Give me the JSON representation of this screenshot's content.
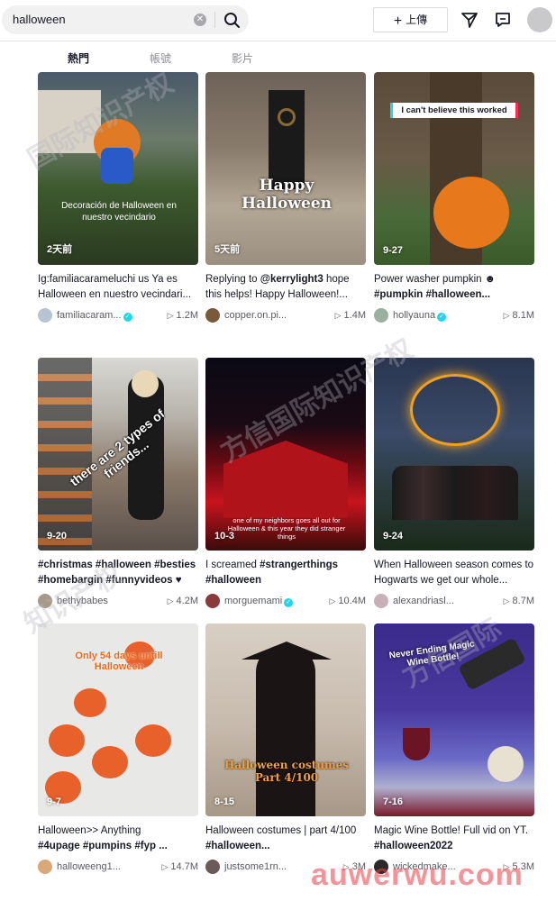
{
  "search": {
    "value": "halloween",
    "clear_icon": "close-circle-icon",
    "button_icon": "search-icon"
  },
  "header": {
    "upload_label": "上傳",
    "upload_icon": "plus-icon",
    "inbox_icon": "paper-plane-icon",
    "messages_icon": "message-icon"
  },
  "tabs": [
    {
      "label": "熱門",
      "active": true
    },
    {
      "label": "帳號",
      "active": false
    },
    {
      "label": "影片",
      "active": false
    }
  ],
  "videos": [
    {
      "date": "2天前",
      "overlay": "Decoración de Halloween en nuestro vecindario",
      "caption_plain": "Ig:familiacarameluchi us Ya es Halloween en nuestro vecindari...",
      "caption_tags": "",
      "user": "familiacaram...",
      "verified": true,
      "views": "1.2M"
    },
    {
      "date": "5天前",
      "overlay": "Happy Halloween",
      "caption_plain": "Replying to ",
      "caption_tags": "@kerrylight3",
      "caption_after": " hope this helps! Happy Halloween!...",
      "user": "copper.on.pi...",
      "verified": false,
      "views": "1.4M"
    },
    {
      "date": "9-27",
      "overlay": "I can't believe this worked",
      "caption_plain": "Power washer pumpkin ",
      "caption_tags": "#pumpkin #halloween...",
      "user": "hollyauna",
      "verified": true,
      "views": "8.1M"
    },
    {
      "date": "9-20",
      "overlay": "there are 2 types of friends...",
      "caption_plain": "",
      "caption_tags": "#christmas #halloween #besties #homebargin #funnyvideos",
      "user": "bethybabes",
      "verified": false,
      "views": "4.2M"
    },
    {
      "date": "10-3",
      "overlay": "one of my neighbors goes all out for Halloween & this year they did stranger things",
      "caption_plain": "I screamed ",
      "caption_tags": "#strangerthings #halloween",
      "user": "morguemami",
      "verified": true,
      "views": "10.4M"
    },
    {
      "date": "9-24",
      "overlay": "",
      "caption_plain": "When Halloween season comes to Hogwarts we get our whole...",
      "caption_tags": "",
      "user": "alexandriasl...",
      "verified": false,
      "views": "8.7M"
    },
    {
      "date": "9-7",
      "overlay": "Only 54 days untill Halloween",
      "caption_plain": "Halloween>> Anything ",
      "caption_tags": "#4upage #pumpins #fyp ...",
      "user": "halloweeng1...",
      "verified": false,
      "views": "14.7M"
    },
    {
      "date": "8-15",
      "overlay": "Halloween costumes Part 4/100",
      "caption_plain": "Halloween costumes | part 4/100 ",
      "caption_tags": "#halloween...",
      "user": "justsome1rn...",
      "verified": false,
      "views": "3M"
    },
    {
      "date": "7-16",
      "overlay": "Never Ending Magic Wine Bottle!",
      "caption_plain": "Magic Wine Bottle! Full vid on YT. ",
      "caption_tags": "#halloween2022",
      "user": "wickedmake...",
      "verified": false,
      "views": "5.3M"
    }
  ],
  "watermark_site": "auwerwu.com",
  "colors": {
    "accent": "#fe2c55",
    "verified": "#20d5ec",
    "text": "#161823",
    "muted": "#8a8b91"
  }
}
